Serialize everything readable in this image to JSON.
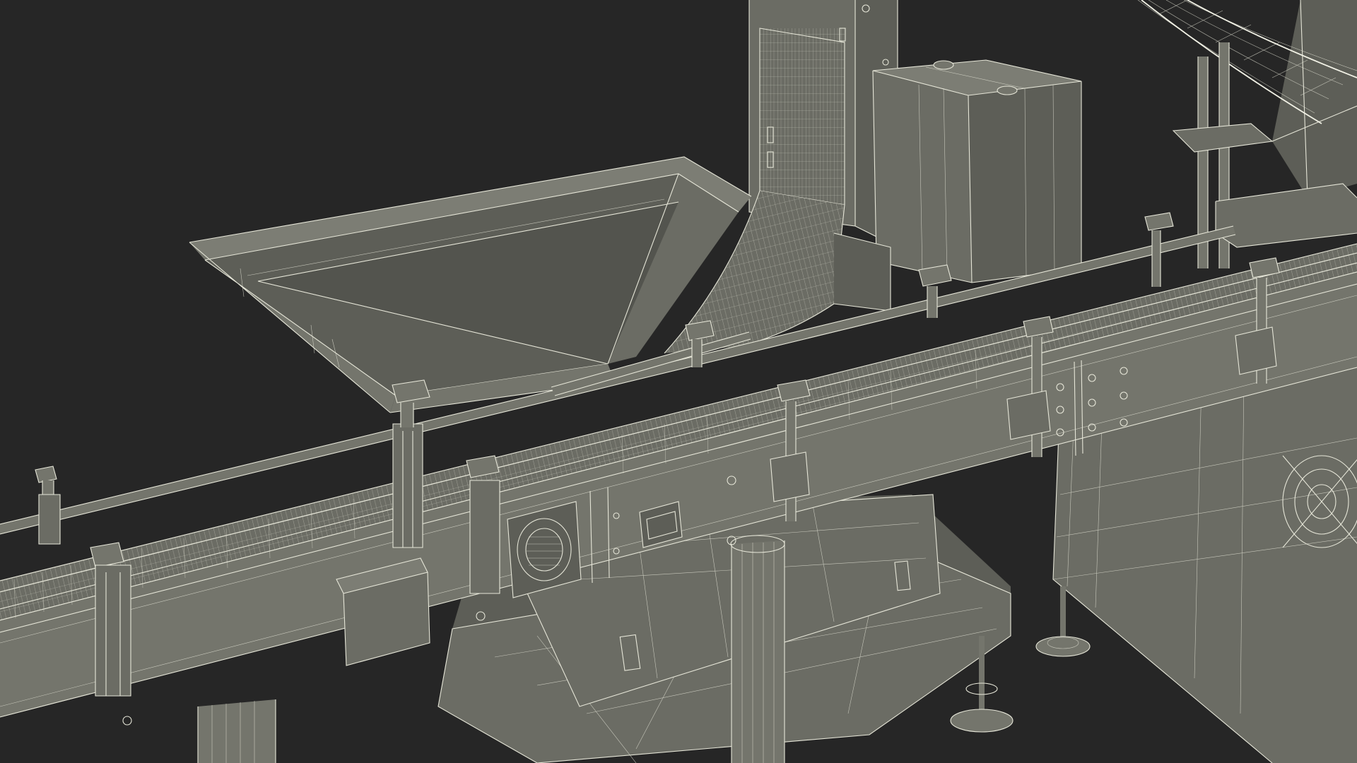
{
  "scene": {
    "background_color": "#262626",
    "surface_color": "#6b6c64",
    "wireframe_color": "#e6e6d8",
    "subject": "",
    "render_style": "wireframe-over-shaded"
  }
}
